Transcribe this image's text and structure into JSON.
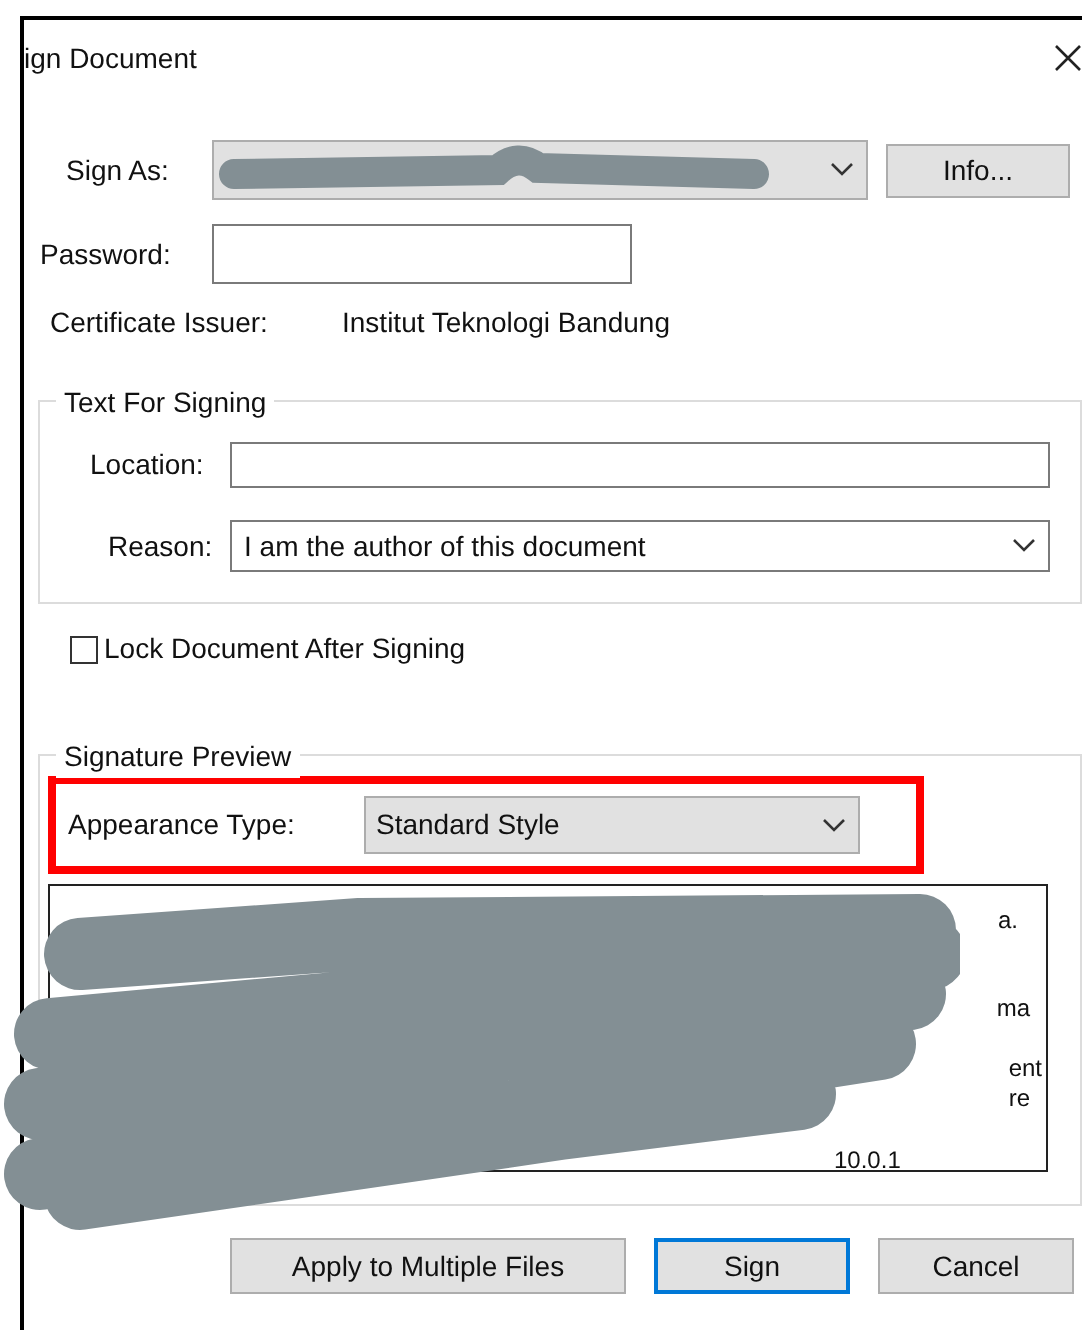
{
  "window": {
    "title": "ign Document"
  },
  "sign_as": {
    "label": "Sign As:",
    "redacted": true,
    "info_button": "Info..."
  },
  "password": {
    "label": "Password:"
  },
  "certificate_issuer": {
    "label": "Certificate Issuer:",
    "value": "Institut Teknologi Bandung"
  },
  "text_for_signing": {
    "title": "Text For Signing",
    "location": {
      "label": "Location:"
    },
    "reason": {
      "label": "Reason:",
      "value": "I am the author of this document"
    }
  },
  "lock_document": {
    "label": "Lock Document After Signing",
    "checked": false
  },
  "signature_preview": {
    "title": "Signature Preview",
    "appearance_type": {
      "label": "Appearance Type:",
      "value": "Standard Style",
      "highlighted": true
    },
    "preview": {
      "redacted": true,
      "fragments": [
        "a.",
        "ma",
        "ent",
        "re",
        "10.0.1"
      ]
    }
  },
  "buttons": [
    {
      "label": "Apply to Multiple Files",
      "selected": false
    },
    {
      "label": "Sign",
      "selected": true
    },
    {
      "label": "Cancel",
      "selected": false
    }
  ]
}
